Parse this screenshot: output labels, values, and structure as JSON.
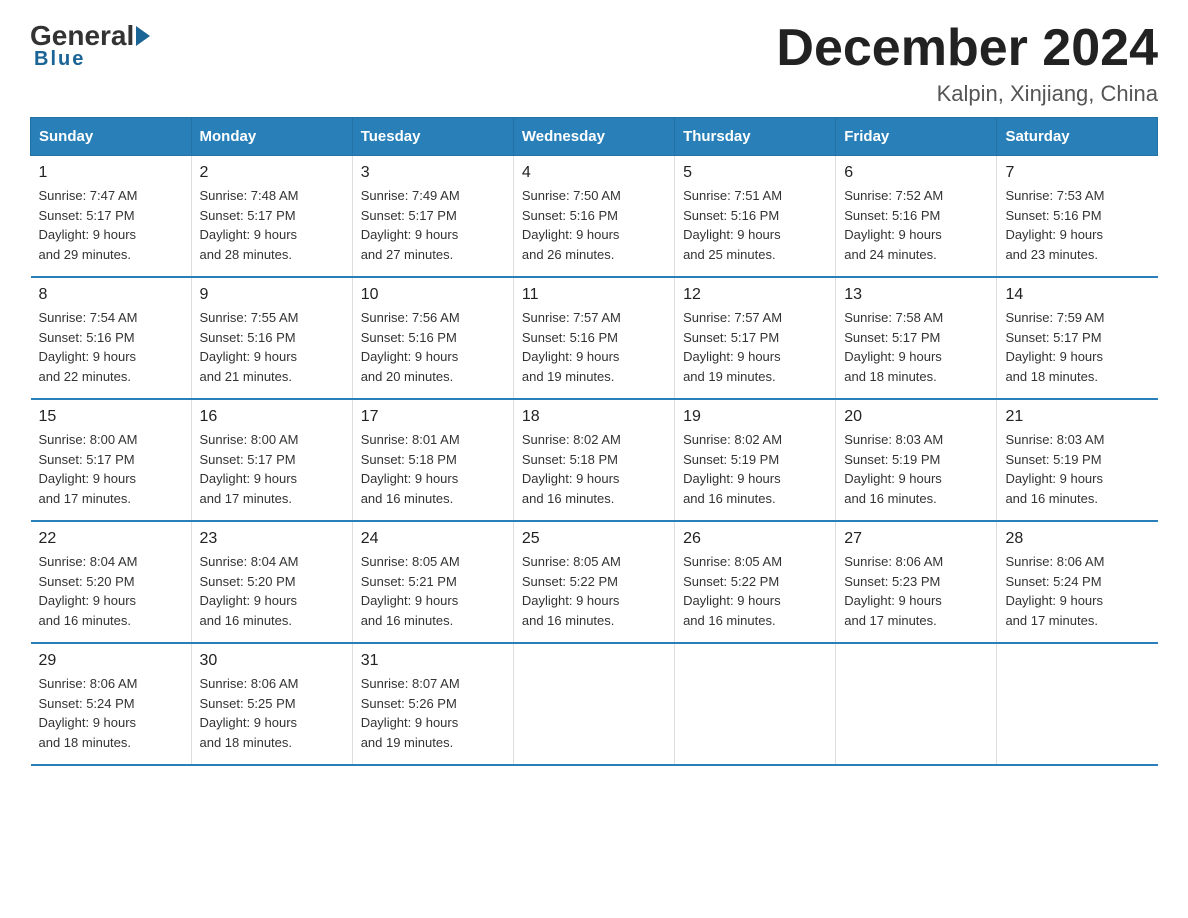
{
  "logo": {
    "general": "General",
    "blue": "Blue",
    "underline": "Blue"
  },
  "header": {
    "title": "December 2024",
    "subtitle": "Kalpin, Xinjiang, China"
  },
  "days_of_week": [
    "Sunday",
    "Monday",
    "Tuesday",
    "Wednesday",
    "Thursday",
    "Friday",
    "Saturday"
  ],
  "weeks": [
    [
      {
        "day": "1",
        "sunrise": "7:47 AM",
        "sunset": "5:17 PM",
        "daylight": "9 hours and 29 minutes."
      },
      {
        "day": "2",
        "sunrise": "7:48 AM",
        "sunset": "5:17 PM",
        "daylight": "9 hours and 28 minutes."
      },
      {
        "day": "3",
        "sunrise": "7:49 AM",
        "sunset": "5:17 PM",
        "daylight": "9 hours and 27 minutes."
      },
      {
        "day": "4",
        "sunrise": "7:50 AM",
        "sunset": "5:16 PM",
        "daylight": "9 hours and 26 minutes."
      },
      {
        "day": "5",
        "sunrise": "7:51 AM",
        "sunset": "5:16 PM",
        "daylight": "9 hours and 25 minutes."
      },
      {
        "day": "6",
        "sunrise": "7:52 AM",
        "sunset": "5:16 PM",
        "daylight": "9 hours and 24 minutes."
      },
      {
        "day": "7",
        "sunrise": "7:53 AM",
        "sunset": "5:16 PM",
        "daylight": "9 hours and 23 minutes."
      }
    ],
    [
      {
        "day": "8",
        "sunrise": "7:54 AM",
        "sunset": "5:16 PM",
        "daylight": "9 hours and 22 minutes."
      },
      {
        "day": "9",
        "sunrise": "7:55 AM",
        "sunset": "5:16 PM",
        "daylight": "9 hours and 21 minutes."
      },
      {
        "day": "10",
        "sunrise": "7:56 AM",
        "sunset": "5:16 PM",
        "daylight": "9 hours and 20 minutes."
      },
      {
        "day": "11",
        "sunrise": "7:57 AM",
        "sunset": "5:16 PM",
        "daylight": "9 hours and 19 minutes."
      },
      {
        "day": "12",
        "sunrise": "7:57 AM",
        "sunset": "5:17 PM",
        "daylight": "9 hours and 19 minutes."
      },
      {
        "day": "13",
        "sunrise": "7:58 AM",
        "sunset": "5:17 PM",
        "daylight": "9 hours and 18 minutes."
      },
      {
        "day": "14",
        "sunrise": "7:59 AM",
        "sunset": "5:17 PM",
        "daylight": "9 hours and 18 minutes."
      }
    ],
    [
      {
        "day": "15",
        "sunrise": "8:00 AM",
        "sunset": "5:17 PM",
        "daylight": "9 hours and 17 minutes."
      },
      {
        "day": "16",
        "sunrise": "8:00 AM",
        "sunset": "5:17 PM",
        "daylight": "9 hours and 17 minutes."
      },
      {
        "day": "17",
        "sunrise": "8:01 AM",
        "sunset": "5:18 PM",
        "daylight": "9 hours and 16 minutes."
      },
      {
        "day": "18",
        "sunrise": "8:02 AM",
        "sunset": "5:18 PM",
        "daylight": "9 hours and 16 minutes."
      },
      {
        "day": "19",
        "sunrise": "8:02 AM",
        "sunset": "5:19 PM",
        "daylight": "9 hours and 16 minutes."
      },
      {
        "day": "20",
        "sunrise": "8:03 AM",
        "sunset": "5:19 PM",
        "daylight": "9 hours and 16 minutes."
      },
      {
        "day": "21",
        "sunrise": "8:03 AM",
        "sunset": "5:19 PM",
        "daylight": "9 hours and 16 minutes."
      }
    ],
    [
      {
        "day": "22",
        "sunrise": "8:04 AM",
        "sunset": "5:20 PM",
        "daylight": "9 hours and 16 minutes."
      },
      {
        "day": "23",
        "sunrise": "8:04 AM",
        "sunset": "5:20 PM",
        "daylight": "9 hours and 16 minutes."
      },
      {
        "day": "24",
        "sunrise": "8:05 AM",
        "sunset": "5:21 PM",
        "daylight": "9 hours and 16 minutes."
      },
      {
        "day": "25",
        "sunrise": "8:05 AM",
        "sunset": "5:22 PM",
        "daylight": "9 hours and 16 minutes."
      },
      {
        "day": "26",
        "sunrise": "8:05 AM",
        "sunset": "5:22 PM",
        "daylight": "9 hours and 16 minutes."
      },
      {
        "day": "27",
        "sunrise": "8:06 AM",
        "sunset": "5:23 PM",
        "daylight": "9 hours and 17 minutes."
      },
      {
        "day": "28",
        "sunrise": "8:06 AM",
        "sunset": "5:24 PM",
        "daylight": "9 hours and 17 minutes."
      }
    ],
    [
      {
        "day": "29",
        "sunrise": "8:06 AM",
        "sunset": "5:24 PM",
        "daylight": "9 hours and 18 minutes."
      },
      {
        "day": "30",
        "sunrise": "8:06 AM",
        "sunset": "5:25 PM",
        "daylight": "9 hours and 18 minutes."
      },
      {
        "day": "31",
        "sunrise": "8:07 AM",
        "sunset": "5:26 PM",
        "daylight": "9 hours and 19 minutes."
      },
      null,
      null,
      null,
      null
    ]
  ],
  "labels": {
    "sunrise": "Sunrise:",
    "sunset": "Sunset:",
    "daylight": "Daylight:"
  }
}
